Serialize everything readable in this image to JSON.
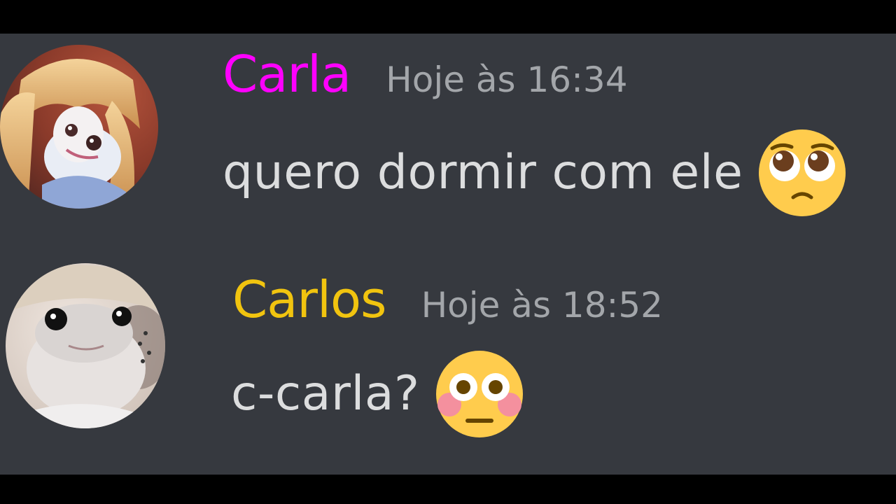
{
  "messages": [
    {
      "username": "Carla",
      "username_color": "#ff00ff",
      "timestamp": "Hoje às 16:34",
      "text": "quero dormir com ele",
      "emoji": "pleading-face",
      "avatar": "blonde-lizard-avatar"
    },
    {
      "username": "Carlos",
      "username_color": "#f1c40f",
      "timestamp": "Hoje às 18:52",
      "text": "c-carla?",
      "emoji": "flushed-face",
      "avatar": "lizard-avatar"
    }
  ],
  "colors": {
    "background": "#36393f",
    "letterbox": "#000000",
    "text": "#dcddde",
    "timestamp": "#a3a6aa"
  }
}
